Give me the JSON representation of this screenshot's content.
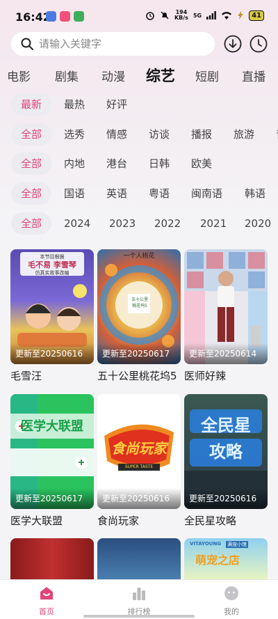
{
  "status": {
    "time": "16:42",
    "net_speed": "194\nKB/s",
    "net_type": "5G",
    "battery": "41"
  },
  "search": {
    "placeholder": "请输入关键字"
  },
  "categories": [
    "电影",
    "剧集",
    "动漫",
    "综艺",
    "短剧",
    "直播"
  ],
  "active_category": "综艺",
  "filters": {
    "sort": [
      "最新",
      "最热",
      "好评"
    ],
    "genre": [
      "全部",
      "选秀",
      "情感",
      "访谈",
      "播报",
      "旅游",
      "音"
    ],
    "region": [
      "全部",
      "内地",
      "港台",
      "日韩",
      "欧美"
    ],
    "language": [
      "全部",
      "国语",
      "英语",
      "粤语",
      "闽南语",
      "韩语"
    ],
    "year": [
      "全部",
      "2024",
      "2023",
      "2022",
      "2021",
      "2020"
    ]
  },
  "items": [
    {
      "title": "毛雪汪",
      "update": "更新至20250616"
    },
    {
      "title": "五十公里桃花坞5",
      "update": "更新至20250617"
    },
    {
      "title": "医师好辣",
      "update": "更新至20250614"
    },
    {
      "title": "医学大联盟",
      "update": "更新至20250617"
    },
    {
      "title": "食尚玩家",
      "update": "更新至20250616"
    },
    {
      "title": "全民星攻略",
      "update": "更新至20250616"
    }
  ],
  "poster_text": {
    "p1_line1": "本节目根据",
    "p1_line2": "毛不易 李雪琴",
    "p1_line3": "仿真实故事改编",
    "p2_line1": "一个人桃花",
    "p2_line2": "五十公里",
    "p2_line3": "桃花坞5",
    "p3": "",
    "p4": "医学大联盟",
    "p5_line1": "食尚玩家",
    "p5_line2": "SUPER TASTE",
    "p6": "全民星攻略",
    "p9_line1": "VITAYOUNG",
    "p9_line2": "满宠小馆",
    "p9_line3": "萌宠之店"
  },
  "nav": [
    {
      "label": "首页"
    },
    {
      "label": "排行榜"
    },
    {
      "label": "我的"
    }
  ],
  "colors": {
    "accent": "#e0457a",
    "chip_bg": "#ececf0"
  }
}
